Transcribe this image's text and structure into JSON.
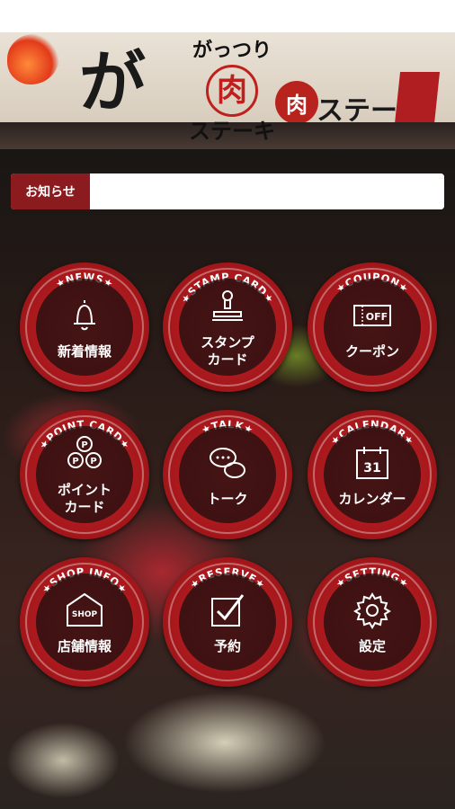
{
  "header": {
    "logo_top": "がっつり",
    "logo_meat": "肉",
    "logo_bottom": "ステーキ",
    "sign_big_text": "が",
    "sign_right_text": "ステーキ",
    "sign_meat": "肉"
  },
  "news": {
    "label": "お知らせ",
    "content": ""
  },
  "menu": [
    {
      "key": "news",
      "arc": "★NEWS★",
      "label": "新着情報",
      "icon": "bell-icon"
    },
    {
      "key": "stamp",
      "arc": "★STAMP CARD★",
      "label": "スタンプ\nカード",
      "icon": "stamp-icon"
    },
    {
      "key": "coupon",
      "arc": "★COUPON★",
      "label": "クーポン",
      "icon": "coupon-icon",
      "icon_text": "OFF"
    },
    {
      "key": "point",
      "arc": "★POINT CARD★",
      "label": "ポイント\nカード",
      "icon": "point-icon",
      "icon_text": "P"
    },
    {
      "key": "talk",
      "arc": "★TALK★",
      "label": "トーク",
      "icon": "chat-icon"
    },
    {
      "key": "calendar",
      "arc": "★CALENDAR★",
      "label": "カレンダー",
      "icon": "calendar-icon",
      "icon_text": "31"
    },
    {
      "key": "shop",
      "arc": "★SHOP INFO★",
      "label": "店舗情報",
      "icon": "shop-icon",
      "icon_text": "SHOP"
    },
    {
      "key": "reserve",
      "arc": "★RESERVE★",
      "label": "予約",
      "icon": "checkbox-icon"
    },
    {
      "key": "setting",
      "arc": "★SETTING★",
      "label": "設定",
      "icon": "gear-icon"
    }
  ],
  "colors": {
    "accent": "#8c1b1f",
    "button_red": "#b01e22"
  }
}
